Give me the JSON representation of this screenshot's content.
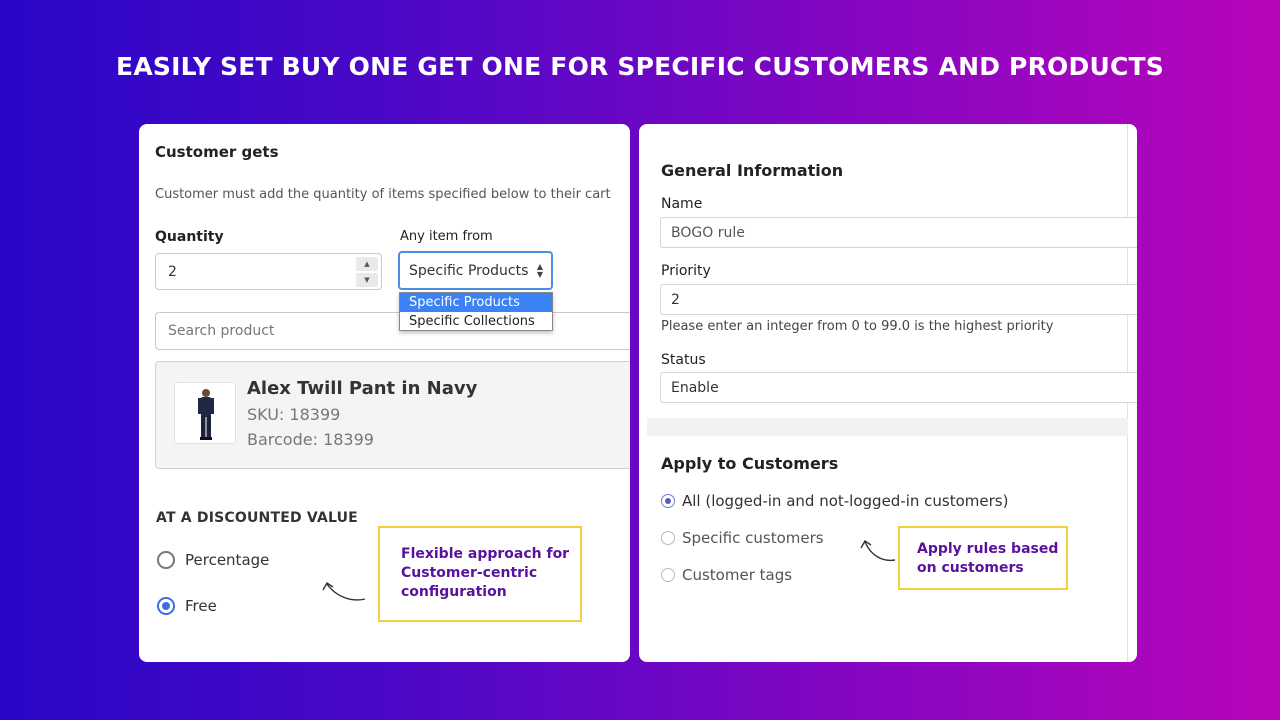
{
  "headline": "EASILY SET BUY ONE GET ONE FOR SPECIFIC CUSTOMERS AND PRODUCTS",
  "left": {
    "title": "Customer gets",
    "description": "Customer must add the quantity of items specified below to their cart",
    "quantity_label": "Quantity",
    "quantity_value": "2",
    "any_item_label": "Any item from",
    "select_value": "Specific Products",
    "dropdown_options": [
      "Specific Products",
      "Specific Collections"
    ],
    "search_placeholder": "Search product",
    "product": {
      "name": "Alex Twill Pant in Navy",
      "sku": "SKU: 18399",
      "barcode": "Barcode: 18399"
    },
    "discount_heading": "AT A DISCOUNTED VALUE",
    "radio_percentage": "Percentage",
    "radio_free": "Free",
    "callout": [
      "Flexible approach for",
      "Customer-centric",
      "configuration"
    ]
  },
  "right": {
    "section1_title": "General Information",
    "name_label": "Name",
    "name_value": "BOGO rule",
    "priority_label": "Priority",
    "priority_value": "2",
    "priority_help": "Please enter an integer from 0 to 99.0 is the highest priority",
    "status_label": "Status",
    "status_value": "Enable",
    "section2_title": "Apply to Customers",
    "radio_all": "All (logged-in and not-logged-in customers)",
    "radio_specific": "Specific customers",
    "radio_tags": "Customer tags",
    "callout": [
      "Apply rules based",
      "on customers"
    ]
  },
  "colors": {
    "accent_blue": "#3b6fe0",
    "callout_border": "#f2cf3c",
    "callout_text": "#5a129c"
  }
}
